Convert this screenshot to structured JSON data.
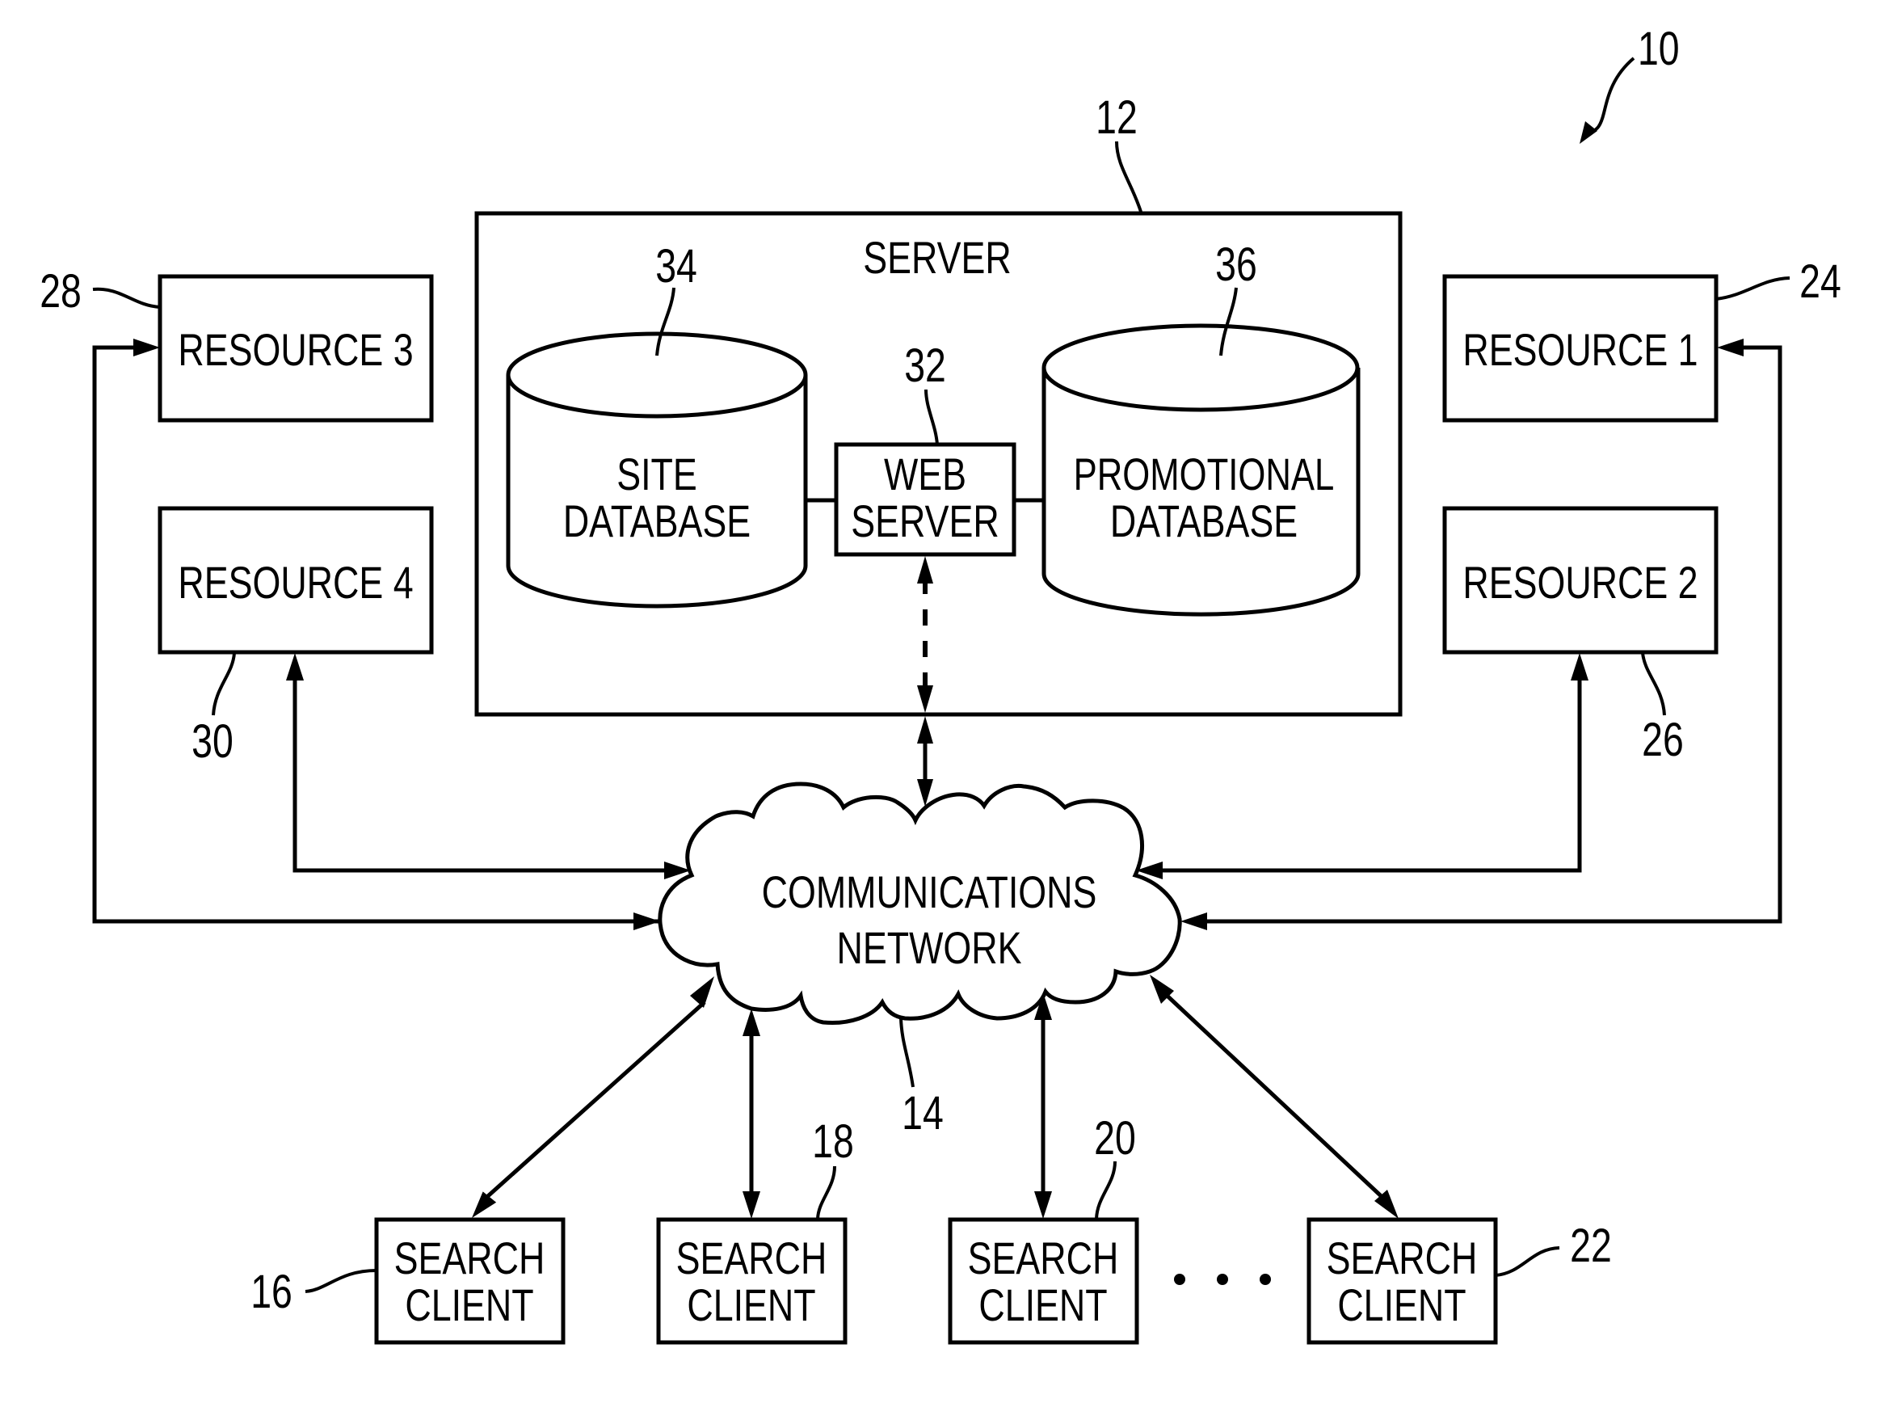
{
  "figure": {
    "figure_ref": "10",
    "server": {
      "ref": "12",
      "label": "SERVER"
    },
    "site_database": {
      "ref": "34",
      "label_lines": [
        "SITE",
        "DATABASE"
      ]
    },
    "web_server": {
      "ref": "32",
      "label_lines": [
        "WEB",
        "SERVER"
      ]
    },
    "promotional_database": {
      "ref": "36",
      "label_lines": [
        "PROMOTIONAL",
        "DATABASE"
      ]
    },
    "network": {
      "ref": "14",
      "label_lines": [
        "COMMUNICATIONS",
        "NETWORK"
      ]
    },
    "resources": [
      {
        "ref": "24",
        "label": "RESOURCE 1"
      },
      {
        "ref": "26",
        "label": "RESOURCE 2"
      },
      {
        "ref": "28",
        "label": "RESOURCE 3"
      },
      {
        "ref": "30",
        "label": "RESOURCE 4"
      }
    ],
    "search_clients": [
      {
        "ref": "16",
        "label_lines": [
          "SEARCH",
          "CLIENT"
        ]
      },
      {
        "ref": "18",
        "label_lines": [
          "SEARCH",
          "CLIENT"
        ]
      },
      {
        "ref": "20",
        "label_lines": [
          "SEARCH",
          "CLIENT"
        ]
      },
      {
        "ref": "22",
        "label_lines": [
          "SEARCH",
          "CLIENT"
        ]
      }
    ],
    "ellipsis": "• • •"
  }
}
